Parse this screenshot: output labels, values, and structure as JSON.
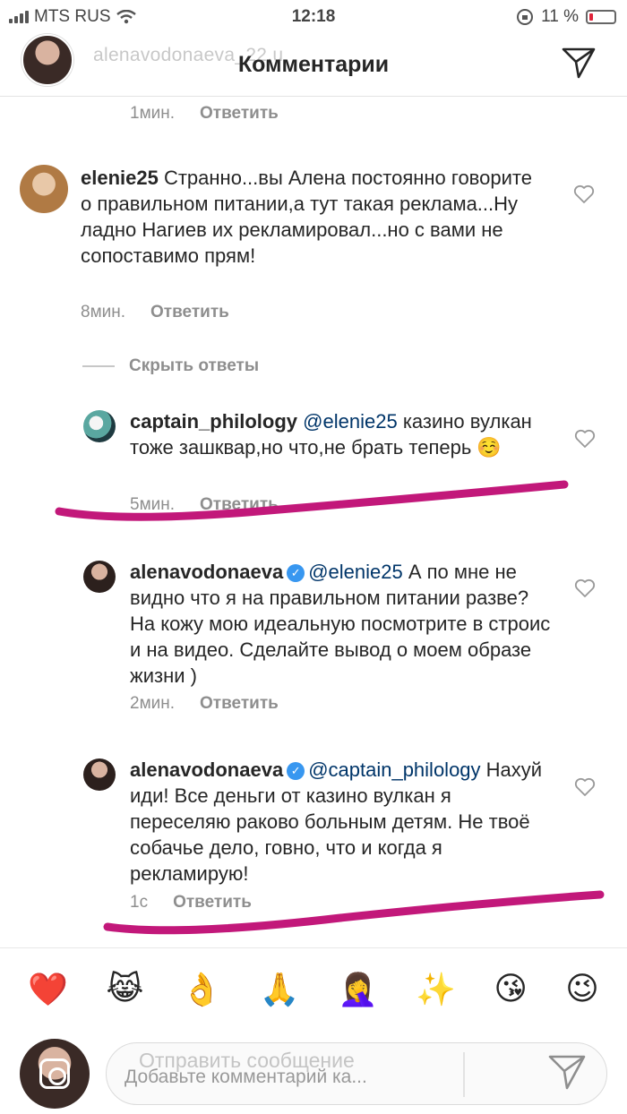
{
  "status_bar": {
    "carrier": "MTS RUS",
    "time": "12:18",
    "battery": "11 %"
  },
  "header": {
    "title": "Комментарии",
    "overlay_username": "alenavodonaeva_22.u"
  },
  "top_meta": {
    "time": "1мин.",
    "reply": "Ответить"
  },
  "comments": [
    {
      "username": "elenie25",
      "text": "Странно...вы Алена постоянно говорите о правильном питании,а тут такая реклама...Ну ладно Нагиев их рекламировал...но с вами не сопоставимо прям!",
      "time": "8мин.",
      "reply": "Ответить"
    }
  ],
  "hide_replies": "Скрыть ответы",
  "replies": [
    {
      "username": "captain_philology",
      "mention": "@elenie25",
      "text": "казино вулкан тоже зашквар,но что,не брать теперь ☺️",
      "time": "5мин.",
      "reply": "Ответить"
    },
    {
      "username": "alenavodonaeva",
      "mention": "@elenie25",
      "text": "А по мне не видно что я на правильном питании разве? На кожу мою идеальную посмотрите в строис и на видео. Сделайте вывод о моем образе жизни )",
      "time": "2мин.",
      "reply": "Ответить"
    },
    {
      "username": "alenavodonaeva",
      "mention": "@captain_philology",
      "text": "Нахуй иди! Все деньги от казино вулкан я переселяю раково больным детям. Не твоё собачье дело, говно, что и когда я рекламирую!",
      "time": "1с",
      "reply": "Ответить"
    }
  ],
  "emoji_bar": [
    "❤️",
    "😹",
    "👌",
    "🙏",
    "🤦‍♀️",
    "✨",
    "😘",
    "😉"
  ],
  "composer": {
    "ghost_text": "Отправить сообщение",
    "placeholder": "Добавьте комментарий ка..."
  },
  "colors": {
    "accent_blue": "#3897f0",
    "mention_blue": "#003569",
    "scribble_magenta": "#c2187a"
  }
}
